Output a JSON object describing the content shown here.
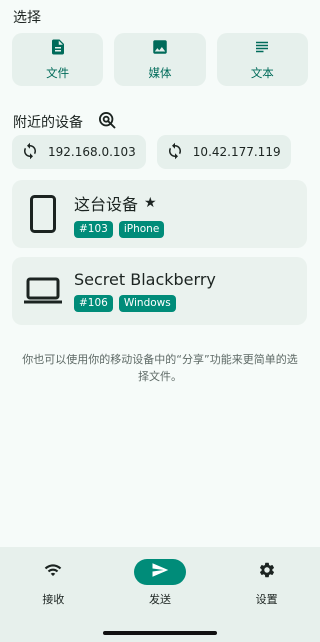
{
  "pick": {
    "title": "选择",
    "buttons": [
      {
        "label": "文件",
        "icon": "file-icon"
      },
      {
        "label": "媒体",
        "icon": "image-icon"
      },
      {
        "label": "文本",
        "icon": "text-icon"
      }
    ]
  },
  "nearby": {
    "title": "附近的设备",
    "addresses": [
      "192.168.0.103",
      "10.42.177.119"
    ]
  },
  "devices": [
    {
      "name": "这台设备",
      "star": "★",
      "id": "#103",
      "os": "iPhone",
      "icon": "phone-icon"
    },
    {
      "name": "Secret Blackberry",
      "id": "#106",
      "os": "Windows",
      "icon": "laptop-icon"
    }
  ],
  "hint": "你也可以使用你的移动设备中的“分享”功能来更简单的选择文件。",
  "nav": {
    "receive": "接收",
    "send": "发送",
    "settings": "设置"
  },
  "colors": {
    "accent": "#008c79",
    "background": "#f6fbf9"
  }
}
